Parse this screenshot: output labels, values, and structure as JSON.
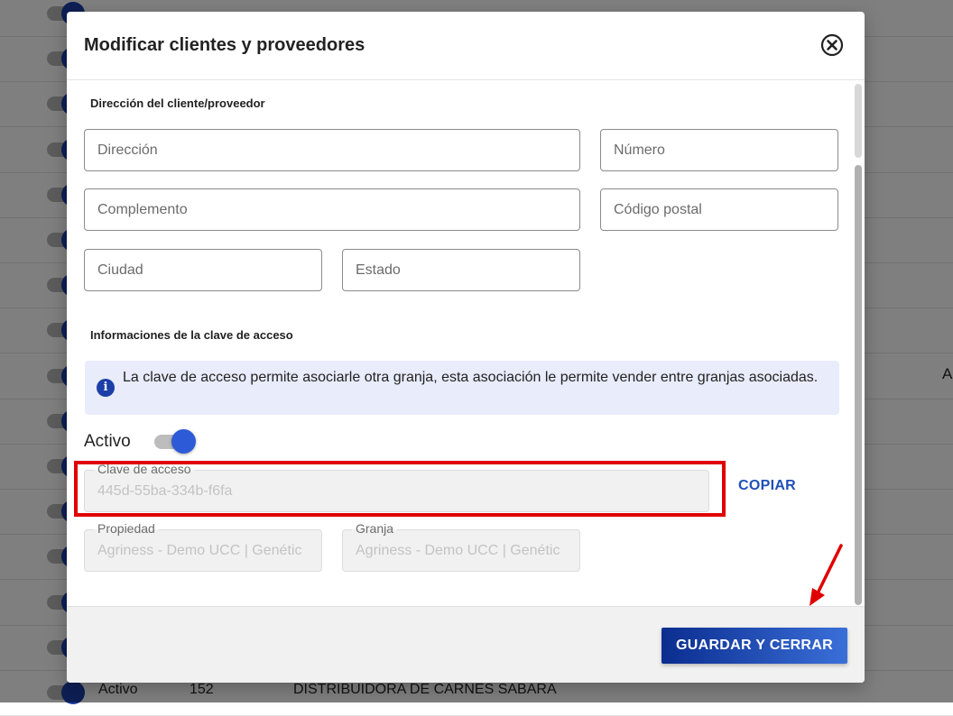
{
  "background": {
    "rows": [
      {
        "status": "",
        "number": "",
        "name": ""
      },
      {
        "status": "",
        "number": "",
        "name": ""
      },
      {
        "status": "",
        "number": "",
        "name": ""
      },
      {
        "status": "",
        "number": "",
        "name": ""
      },
      {
        "status": "",
        "number": "",
        "name": ""
      },
      {
        "status": "",
        "number": "",
        "name": ""
      },
      {
        "status": "",
        "number": "",
        "name": ""
      },
      {
        "status": "",
        "number": "",
        "name": ""
      },
      {
        "status": "",
        "number": "",
        "name": ""
      },
      {
        "status": "",
        "number": "",
        "name": ""
      },
      {
        "status": "",
        "number": "",
        "name": ""
      },
      {
        "status": "",
        "number": "",
        "name": ""
      },
      {
        "status": "",
        "number": "",
        "name": ""
      },
      {
        "status": "",
        "number": "",
        "name": ""
      },
      {
        "status": "",
        "number": "",
        "name": ""
      },
      {
        "status": "Activo",
        "number": "152",
        "name": "DISTRIBUIDORA DE CARNES SABARA"
      }
    ],
    "right_fragment": "A"
  },
  "modal": {
    "title": "Modificar clientes y proveedores",
    "address_section_title": "Dirección del cliente/proveedor",
    "fields": {
      "direccion_placeholder": "Dirección",
      "numero_placeholder": "Número",
      "complemento_placeholder": "Complemento",
      "codigo_postal_placeholder": "Código postal",
      "ciudad_placeholder": "Ciudad",
      "estado_placeholder": "Estado"
    },
    "access_section_title": "Informaciones de la clave de acceso",
    "info_text": "La clave de acceso permite asociarle otra granja, esta asociación le permite vender entre granjas asociadas.",
    "toggle_label": "Activo",
    "toggle_on": true,
    "clave": {
      "label": "Clave de acceso",
      "value": "445d-55ba-334b-f6fa"
    },
    "copy_label": "COPIAR",
    "propiedad": {
      "label": "Propiedad",
      "value": "Agriness - Demo UCC | Genétic"
    },
    "granja": {
      "label": "Granja",
      "value": "Agriness - Demo UCC | Genétic"
    },
    "save_label": "GUARDAR Y CERRAR"
  },
  "colors": {
    "primary": "#1d3fa8",
    "highlight": "#e00000",
    "info_bg": "#e8ecfb",
    "toggle_knob": "#2d5ad6"
  }
}
